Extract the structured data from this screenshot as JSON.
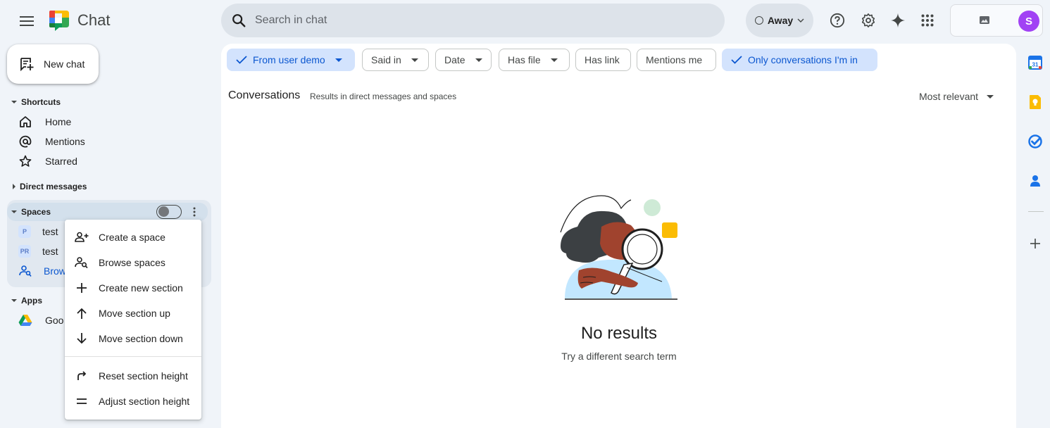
{
  "app": {
    "title": "Chat"
  },
  "search": {
    "placeholder": "Search in chat"
  },
  "status": {
    "label": "Away"
  },
  "account": {
    "avatar_letter": "S",
    "avatar_color": "#a142f4"
  },
  "sidebar": {
    "new_chat_label": "New chat",
    "shortcuts": {
      "heading": "Shortcuts",
      "items": [
        {
          "label": "Home",
          "icon": "home-icon"
        },
        {
          "label": "Mentions",
          "icon": "at-icon"
        },
        {
          "label": "Starred",
          "icon": "star-icon"
        }
      ]
    },
    "direct_messages": {
      "heading": "Direct messages"
    },
    "spaces": {
      "heading": "Spaces",
      "items": [
        {
          "badge": "P",
          "label": "test"
        },
        {
          "badge": "PR",
          "label": "test"
        },
        {
          "label": "Brow",
          "icon": "browse-spaces-icon"
        }
      ]
    },
    "apps": {
      "heading": "Apps",
      "items": [
        {
          "label": "Goo",
          "icon": "google-drive-icon"
        }
      ]
    }
  },
  "context_menu": {
    "items": [
      {
        "label": "Create a space",
        "icon": "create-space-icon"
      },
      {
        "label": "Browse spaces",
        "icon": "browse-spaces-icon"
      },
      {
        "label": "Create new section",
        "icon": "plus-icon"
      },
      {
        "label": "Move section up",
        "icon": "arrow-up-icon"
      },
      {
        "label": "Move section down",
        "icon": "arrow-down-icon"
      },
      {
        "label": "Reset section height",
        "icon": "reset-icon"
      },
      {
        "label": "Adjust section height",
        "icon": "equals-icon"
      }
    ]
  },
  "filters": [
    {
      "label": "From user demo",
      "selected": true,
      "dropdown": true
    },
    {
      "label": "Said in",
      "selected": false,
      "dropdown": true
    },
    {
      "label": "Date",
      "selected": false,
      "dropdown": true
    },
    {
      "label": "Has file",
      "selected": false,
      "dropdown": true
    },
    {
      "label": "Has link",
      "selected": false,
      "dropdown": false
    },
    {
      "label": "Mentions me",
      "selected": false,
      "dropdown": false
    },
    {
      "label": "Only conversations I'm in",
      "selected": true,
      "dropdown": false
    }
  ],
  "results": {
    "title": "Conversations",
    "subtitle": "Results in direct messages and spaces",
    "sort_label": "Most relevant",
    "empty_title": "No results",
    "empty_subtitle": "Try a different search term"
  },
  "colors": {
    "accent": "#0b57d0",
    "selected_chip_bg": "#d3e3fd",
    "page_bg": "#f0f4f9"
  }
}
